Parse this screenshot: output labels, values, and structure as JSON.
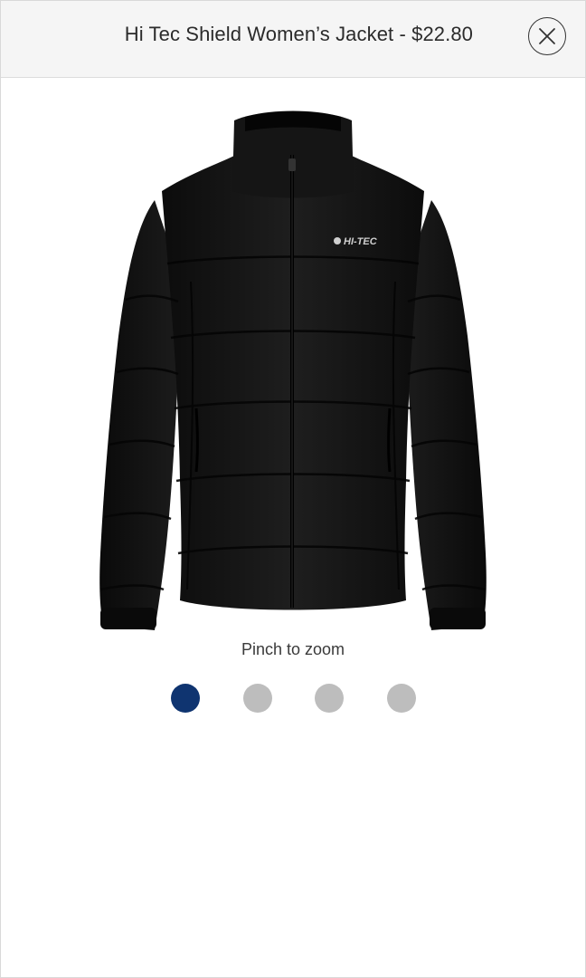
{
  "header": {
    "title": "Hi Tec Shield Women’s Jacket - $22.80",
    "close_icon": "close-x-icon"
  },
  "product_image": {
    "logo_text": "HI-TEC",
    "color": "#101010"
  },
  "caption": "Pinch to zoom",
  "carousel": {
    "active_color": "#0f3470",
    "inactive_color": "#bdbdbd",
    "dots": [
      {
        "active": true
      },
      {
        "active": false
      },
      {
        "active": false
      },
      {
        "active": false
      }
    ]
  }
}
